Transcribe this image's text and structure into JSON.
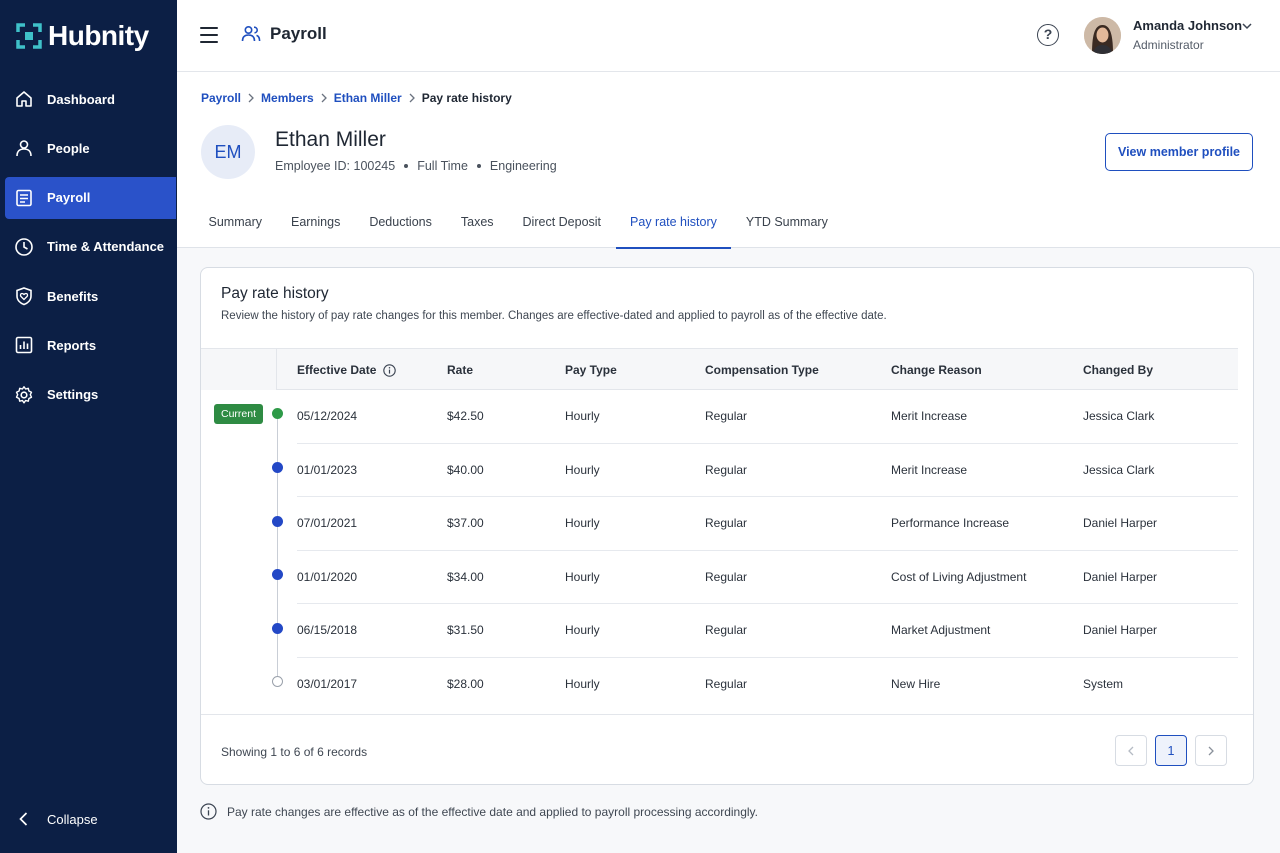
{
  "brand": {
    "name": "Hubnity"
  },
  "sidebar": {
    "items": [
      {
        "label": "Dashboard",
        "icon": "home-icon"
      },
      {
        "label": "People",
        "icon": "person-icon"
      },
      {
        "label": "Payroll",
        "icon": "payroll-icon",
        "active": true
      },
      {
        "label": "Time & Attendance",
        "icon": "clock-icon"
      },
      {
        "label": "Benefits",
        "icon": "heart-shield-icon"
      },
      {
        "label": "Reports",
        "icon": "chart-icon"
      },
      {
        "label": "Settings",
        "icon": "gear-icon"
      }
    ],
    "collapse_label": "Collapse"
  },
  "header": {
    "app_title": "Payroll",
    "user": {
      "name": "Amanda Johnson",
      "role": "Administrator"
    }
  },
  "breadcrumb": [
    "Payroll",
    "Members",
    "Ethan Miller",
    "Pay rate history"
  ],
  "member": {
    "initials": "EM",
    "name": "Ethan Miller",
    "employee_id": "Employee ID: 100245",
    "employment": "Full Time",
    "department": "Engineering",
    "view_profile_label": "View member profile"
  },
  "tabs": [
    "Summary",
    "Earnings",
    "Deductions",
    "Taxes",
    "Direct Deposit",
    "Pay rate history",
    "YTD Summary"
  ],
  "active_tab": "Pay rate history",
  "card": {
    "title": "Pay rate history",
    "description": "Review the history of pay rate changes for this member. Changes are effective-dated and applied to payroll as of the effective date."
  },
  "table": {
    "columns": [
      "Effective Date",
      "Rate",
      "Pay Type",
      "Compensation Type",
      "Change Reason",
      "Changed By"
    ],
    "current_badge": "Current",
    "rows": [
      {
        "date": "05/12/2024",
        "rate": "$42.50",
        "pay_type": "Hourly",
        "comp_type": "Regular",
        "reason": "Merit Increase",
        "by": "Jessica Clark",
        "current": true
      },
      {
        "date": "01/01/2023",
        "rate": "$40.00",
        "pay_type": "Hourly",
        "comp_type": "Regular",
        "reason": "Merit Increase",
        "by": "Jessica Clark"
      },
      {
        "date": "07/01/2021",
        "rate": "$37.00",
        "pay_type": "Hourly",
        "comp_type": "Regular",
        "reason": "Performance Increase",
        "by": "Daniel Harper"
      },
      {
        "date": "01/01/2020",
        "rate": "$34.00",
        "pay_type": "Hourly",
        "comp_type": "Regular",
        "reason": "Cost of Living Adjustment",
        "by": "Daniel Harper"
      },
      {
        "date": "06/15/2018",
        "rate": "$31.50",
        "pay_type": "Hourly",
        "comp_type": "Regular",
        "reason": "Market Adjustment",
        "by": "Daniel Harper"
      },
      {
        "date": "03/01/2017",
        "rate": "$28.00",
        "pay_type": "Hourly",
        "comp_type": "Regular",
        "reason": "New Hire",
        "by": "System"
      }
    ]
  },
  "pagination": {
    "showing": "Showing 1 to 6 of 6 records",
    "current_page": "1"
  },
  "footnote": "Pay rate changes are effective as of the effective date and applied to payroll processing accordingly.",
  "colors": {
    "sidebar_bg": "#0c1f45",
    "accent": "#1f4fbf",
    "active_nav": "#2a52c9",
    "current_badge": "#2e8b43"
  }
}
